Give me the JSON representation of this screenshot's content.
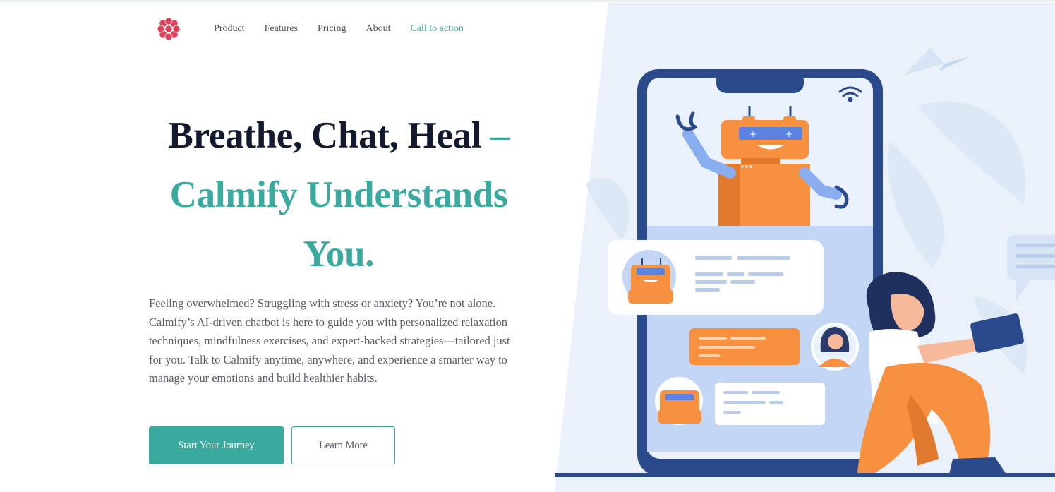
{
  "nav": {
    "logo_icon": "flower-mandala-icon",
    "links": [
      {
        "label": "Product"
      },
      {
        "label": "Features"
      },
      {
        "label": "Pricing"
      },
      {
        "label": "About"
      },
      {
        "label": "Call to action"
      }
    ]
  },
  "hero": {
    "title_line": "Breathe, Chat, Heal",
    "title_dash": "–",
    "title_teal": "Calmify Understands You.",
    "description": "Feeling overwhelmed? Struggling with stress or anxiety? You’re not alone. Calmify’s AI-driven chatbot is here to guide you with personalized relaxation techniques, mindfulness exercises, and expert-backed strategies—tailored just for you. Talk to Calmify anytime, anywhere, and experience a smarter way to manage your emotions and build healthier habits.",
    "primary_button": "Start Your Journey",
    "secondary_button": "Learn More"
  },
  "colors": {
    "accent": "#3aa99e",
    "heading": "#141a2e",
    "logo": "#e0405a",
    "phone_frame": "#2a4a8c",
    "robot": "#f7913f",
    "illustration_bg": "#eaf1fa"
  },
  "illustration": {
    "icons": [
      "paper-plane-icon",
      "wifi-icon",
      "robot-icon",
      "chat-bubble-icon",
      "woman-with-tablet-icon"
    ]
  }
}
